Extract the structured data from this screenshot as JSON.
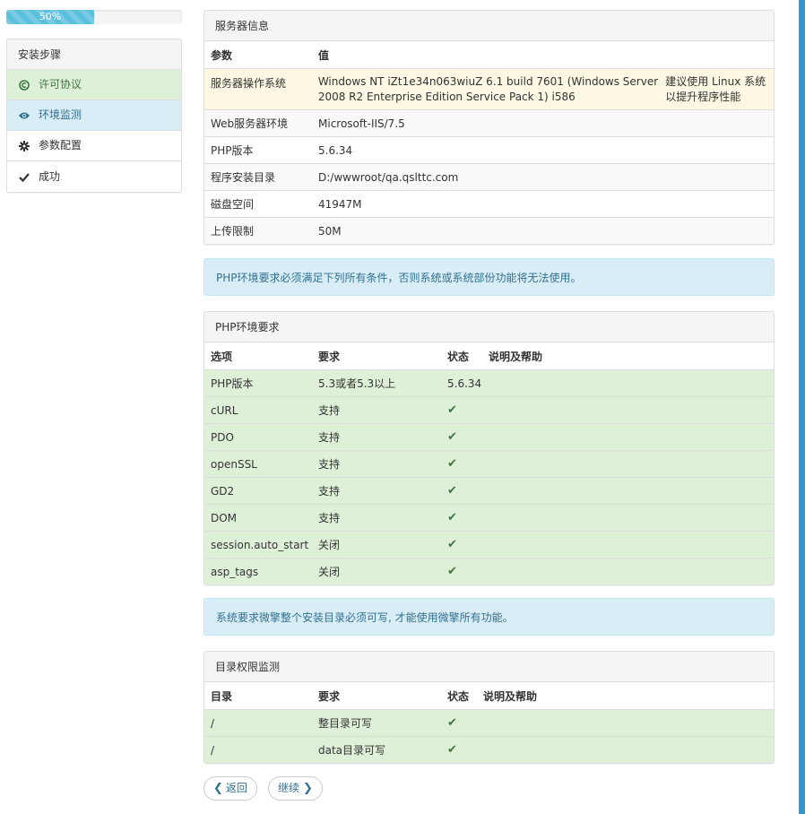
{
  "progress": {
    "label": "50%",
    "percent": 50
  },
  "steps": {
    "title": "安装步骤",
    "items": [
      {
        "label": "许可协议",
        "icon": "copyright-icon",
        "state": "done"
      },
      {
        "label": "环境监测",
        "icon": "eye-icon",
        "state": "current"
      },
      {
        "label": "参数配置",
        "icon": "gear-icon",
        "state": "todo"
      },
      {
        "label": "成功",
        "icon": "check-icon",
        "state": "todo"
      }
    ]
  },
  "server_panel": {
    "title": "服务器信息",
    "headers": [
      "参数",
      "值"
    ],
    "rows": [
      {
        "param": "服务器操作系统",
        "value": "Windows NT iZt1e34n063wiuZ 6.1 build 7601 (Windows Server 2008 R2 Enterprise Edition Service Pack 1) i586",
        "note": "建议使用 Linux 系统以提升程序性能"
      },
      {
        "param": "Web服务器环境",
        "value": "Microsoft-IIS/7.5"
      },
      {
        "param": "PHP版本",
        "value": "5.6.34"
      },
      {
        "param": "程序安装目录",
        "value": "D:/wwwroot/qa.qslttc.com"
      },
      {
        "param": "磁盘空间",
        "value": "41947M"
      },
      {
        "param": "上传限制",
        "value": "50M"
      }
    ]
  },
  "alert1": "PHP环境要求必须满足下列所有条件，否则系统或系统部份功能将无法使用。",
  "php_panel": {
    "title": "PHP环境要求",
    "headers": [
      "选项",
      "要求",
      "状态",
      "说明及帮助"
    ],
    "rows": [
      {
        "option": "PHP版本",
        "req": "5.3或者5.3以上",
        "status": "5.6.34"
      },
      {
        "option": "cURL",
        "req": "支持"
      },
      {
        "option": "PDO",
        "req": "支持"
      },
      {
        "option": "openSSL",
        "req": "支持"
      },
      {
        "option": "GD2",
        "req": "支持"
      },
      {
        "option": "DOM",
        "req": "支持"
      },
      {
        "option": "session.auto_start",
        "req": "关闭"
      },
      {
        "option": "asp_tags",
        "req": "关闭"
      }
    ]
  },
  "alert2": "系统要求微擎整个安装目录必须可写, 才能使用微擎所有功能。",
  "dir_panel": {
    "title": "目录权限监测",
    "headers": [
      "目录",
      "要求",
      "状态",
      "说明及帮助"
    ],
    "rows": [
      {
        "dir": "/",
        "req": "整目录可写"
      },
      {
        "dir": "/",
        "req": "data目录可写"
      }
    ]
  },
  "buttons": {
    "back": "返回",
    "next": "继续"
  },
  "colors": {
    "accent": "#3097d1",
    "success_bg": "#dff0d8",
    "info_bg": "#d9edf7",
    "warning_bg": "#fcf8e3"
  }
}
